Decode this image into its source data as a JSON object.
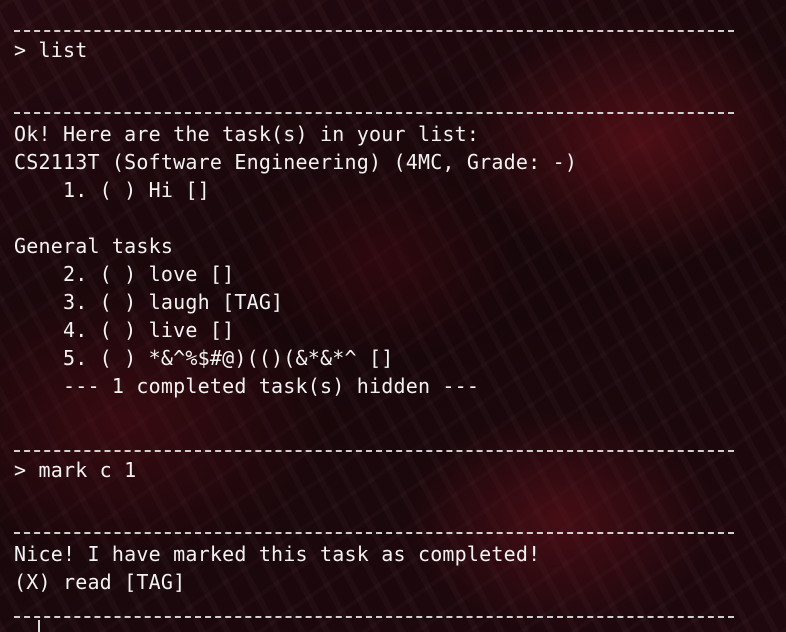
{
  "terminal": {
    "lines": [
      "> list",
      "Ok! Here are the task(s) in your list:",
      "CS2113T (Software Engineering) (4MC, Grade: -)",
      "    1. ( ) Hi []",
      "General tasks",
      "    2. ( ) love []",
      "    3. ( ) laugh [TAG]",
      "    4. ( ) live []",
      "    5. ( ) *&^%$#@)(()(&*&*^ []",
      "    --- 1 completed task(s) hidden ---",
      "> mark c 1",
      "Nice! I have marked this task as completed!",
      "(X) read [TAG]"
    ]
  }
}
